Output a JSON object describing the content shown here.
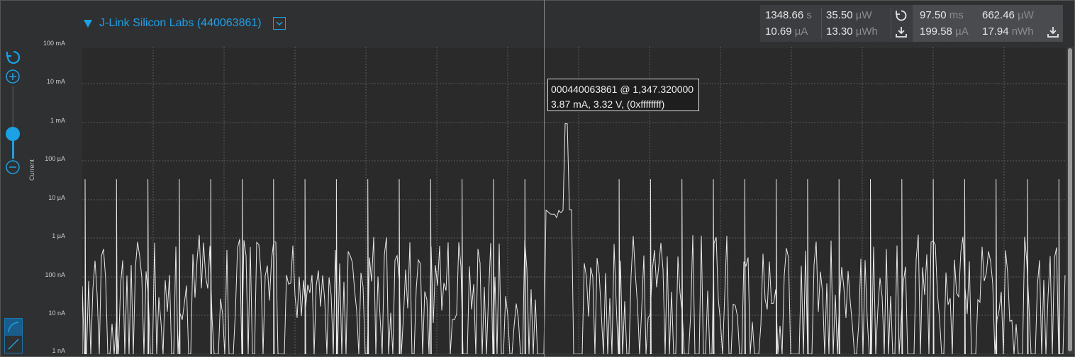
{
  "device": {
    "title": "J-Link Silicon Labs (440063861)"
  },
  "stats": {
    "left": {
      "time": {
        "value": "1348.66",
        "unit": "s"
      },
      "power": {
        "value": "35.50",
        "unit": "µW"
      },
      "current": {
        "value": "10.69",
        "unit": "µA"
      },
      "energy": {
        "value": "13.30",
        "unit": "µWh"
      }
    },
    "right": {
      "time": {
        "value": "97.50",
        "unit": "ms"
      },
      "power": {
        "value": "662.46",
        "unit": "µW"
      },
      "current": {
        "value": "199.58",
        "unit": "µA"
      },
      "energy": {
        "value": "17.94",
        "unit": "nWh"
      }
    }
  },
  "axis": {
    "ylabel": "Current",
    "ticks": [
      "100 mA",
      "10 mA",
      "1 mA",
      "100 µA",
      "10 µA",
      "1 µA",
      "100 nA",
      "10 nA",
      "1 nA"
    ]
  },
  "tooltip": {
    "line1": "000440063861 @ 1,347.320000",
    "line2": "3.87 mA, 3.32 V, (0xffffffff)"
  },
  "colors": {
    "accent": "#1aa1e6",
    "background": "#2f3032",
    "plot_bg": "#2a2a2b",
    "trace": "#e8e8e8"
  }
}
